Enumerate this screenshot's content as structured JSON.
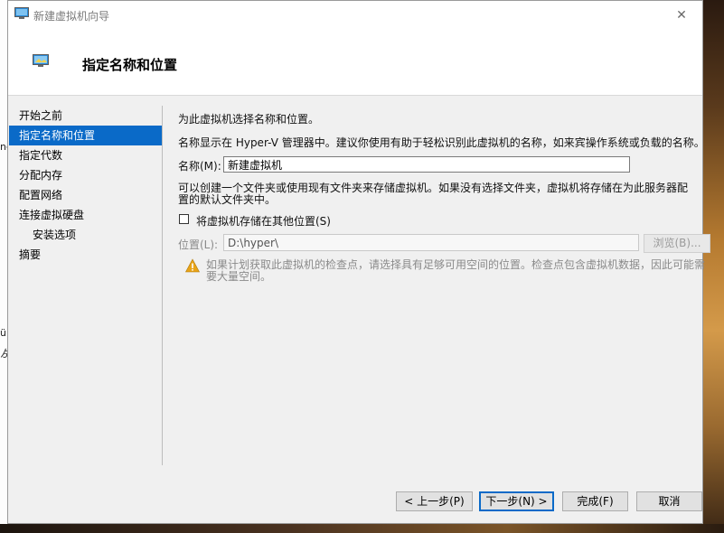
{
  "window": {
    "title": "新建虚拟机向导",
    "close_glyph": "✕",
    "header_title": "指定名称和位置"
  },
  "nav": {
    "items": [
      {
        "label": "开始之前",
        "active": false,
        "sub": false
      },
      {
        "label": "指定名称和位置",
        "active": true,
        "sub": false
      },
      {
        "label": "指定代数",
        "active": false,
        "sub": false
      },
      {
        "label": "分配内存",
        "active": false,
        "sub": false
      },
      {
        "label": "配置网络",
        "active": false,
        "sub": false
      },
      {
        "label": "连接虚拟硬盘",
        "active": false,
        "sub": false
      },
      {
        "label": "安装选项",
        "active": false,
        "sub": true
      },
      {
        "label": "摘要",
        "active": false,
        "sub": false
      }
    ]
  },
  "content": {
    "intro": "为此虚拟机选择名称和位置。",
    "name_hint": "名称显示在 Hyper-V 管理器中。建议你使用有助于轻松识别此虚拟机的名称，如来宾操作系统或负载的名称。",
    "name_label": "名称(M):",
    "name_value": "新建虚拟机",
    "folder_hint": "可以创建一个文件夹或使用现有文件夹来存储虚拟机。如果没有选择文件夹，虚拟机将存储在为此服务器配置的默认文件夹中。",
    "store_checkbox_label": "将虚拟机存储在其他位置(S)",
    "store_checked": false,
    "location_label": "位置(L):",
    "location_value": "D:\\hyper\\",
    "browse_label": "浏览(B)...",
    "warning_text": "如果计划获取此虚拟机的检查点，请选择具有足够可用空间的位置。检查点包含虚拟机数据，因此可能需要大量空间。"
  },
  "buttons": {
    "previous": "< 上一步(P)",
    "next": "下一步(N) >",
    "finish": "完成(F)",
    "cancel": "取消"
  },
  "colors": {
    "accent": "#0a6ac8",
    "warning": "#e8a317"
  },
  "icons": {
    "title": "monitor-icon",
    "header": "monitor-icon",
    "warning": "warning-icon",
    "close": "close-icon"
  }
}
